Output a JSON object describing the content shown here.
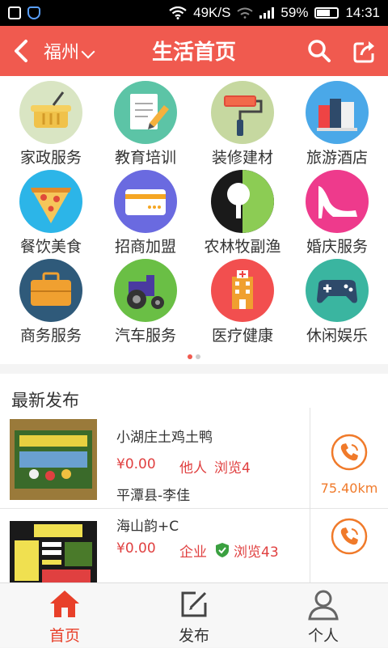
{
  "status": {
    "speed": "49K/S",
    "battery": "59%",
    "time": "14:31"
  },
  "header": {
    "city": "福州",
    "title": "生活首页"
  },
  "categories": [
    {
      "label": "家政服务",
      "icon": "basket-icon",
      "color": "#d9e5c3"
    },
    {
      "label": "教育培训",
      "icon": "notebook-pencil-icon",
      "color": "#5cc4a6"
    },
    {
      "label": "装修建材",
      "icon": "paint-roller-icon",
      "color": "#c6d8a0"
    },
    {
      "label": "旅游酒店",
      "icon": "suitcase-icon",
      "color": "#4aa8e8"
    },
    {
      "label": "餐饮美食",
      "icon": "pizza-icon",
      "color": "#2cb5e8"
    },
    {
      "label": "招商加盟",
      "icon": "credit-card-icon",
      "color": "#6a6ae0"
    },
    {
      "label": "农林牧副渔",
      "icon": "tree-icon",
      "color": "#7cbf47"
    },
    {
      "label": "婚庆服务",
      "icon": "high-heel-icon",
      "color": "#ee3a8c"
    },
    {
      "label": "商务服务",
      "icon": "briefcase-icon",
      "color": "#2f5a7a"
    },
    {
      "label": "汽车服务",
      "icon": "tractor-icon",
      "color": "#6abf45"
    },
    {
      "label": "医疗健康",
      "icon": "hospital-icon",
      "color": "#f24f4f"
    },
    {
      "label": "休闲娱乐",
      "icon": "gamepad-icon",
      "color": "#3ab5a0"
    }
  ],
  "latest": {
    "title": "最新发布",
    "items": [
      {
        "name": "小湖庄土鸡土鸭",
        "price": "¥0.00",
        "tag": "他人",
        "views": "浏览4",
        "location": "平潭县-李佳",
        "distance": "75.40km"
      },
      {
        "name": "海山韵+C",
        "price": "¥0.00",
        "tag": "企业",
        "views": "浏览43",
        "location": "",
        "distance": ""
      }
    ]
  },
  "nav": {
    "home": "首页",
    "publish": "发布",
    "profile": "个人"
  },
  "colors": {
    "accent": "#f05a4f",
    "price": "#e04040",
    "distance": "#f07a2a"
  }
}
